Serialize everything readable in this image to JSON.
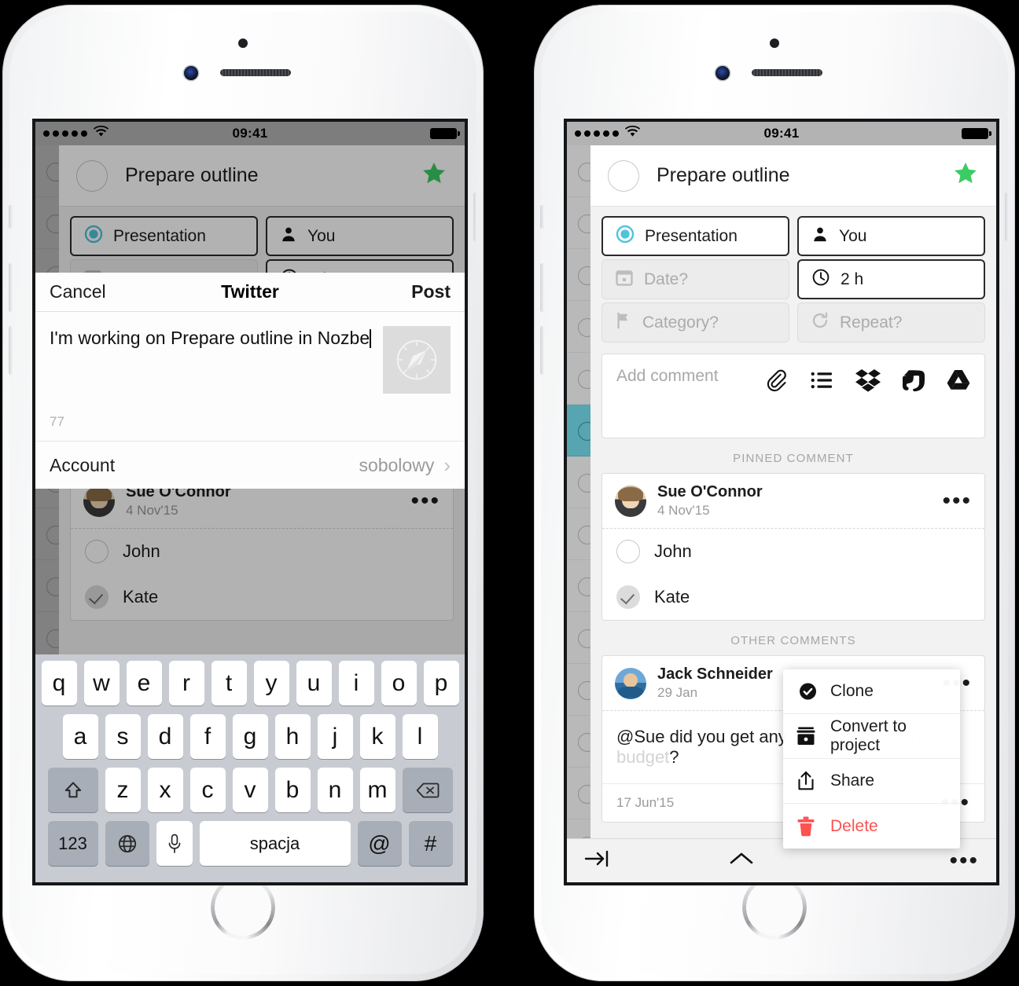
{
  "status_bar": {
    "time": "09:41",
    "signal_dots": 5,
    "wifi": "wifi-icon",
    "battery": "battery-full-icon"
  },
  "task": {
    "title": "Prepare outline",
    "star_color": "#3bcc63",
    "attributes": [
      {
        "label": "Presentation",
        "icon": "project-dot-icon",
        "state": "active"
      },
      {
        "label": "You",
        "icon": "person-icon",
        "state": "active"
      },
      {
        "label": "Date?",
        "icon": "calendar-icon",
        "state": "inactive"
      },
      {
        "label": "2 h",
        "icon": "clock-icon",
        "state": "active"
      },
      {
        "label": "Category?",
        "icon": "flag-icon",
        "state": "inactive"
      },
      {
        "label": "Repeat?",
        "icon": "repeat-icon",
        "state": "inactive"
      }
    ]
  },
  "comment_composer": {
    "placeholder": "Add comment",
    "attachments": [
      {
        "name": "paperclip-icon"
      },
      {
        "name": "checklist-icon"
      },
      {
        "name": "dropbox-icon"
      },
      {
        "name": "evernote-icon"
      },
      {
        "name": "google-drive-icon"
      }
    ]
  },
  "sections": {
    "pinned": "PINNED COMMENT",
    "other": "OTHER COMMENTS"
  },
  "pinned_comment": {
    "author": "Sue O'Connor",
    "date": "4 Nov'15",
    "checklist": [
      {
        "label": "John",
        "done": false
      },
      {
        "label": "Kate",
        "done": true
      }
    ]
  },
  "other_comment": {
    "author": "Jack Schneider",
    "date": "29 Jan",
    "body_visible_start": "@Sue did you get any",
    "body_obscured": " feedback from the budget",
    "body_visible_end": "?",
    "footer_date": "17 Jun'15"
  },
  "bottom_bar": {
    "left_icon": "indent-arrow-icon",
    "center_icon": "chevron-up-icon",
    "right_icon": "more-dots-icon"
  },
  "context_menu": {
    "items": [
      {
        "label": "Clone",
        "icon": "clone-icon",
        "danger": false
      },
      {
        "label": "Convert to project",
        "icon": "archive-box-icon",
        "danger": false
      },
      {
        "label": "Share",
        "icon": "share-upload-icon",
        "danger": false
      },
      {
        "label": "Delete",
        "icon": "trash-icon",
        "danger": true
      }
    ],
    "danger_color": "#fd5252"
  },
  "twitter_sheet": {
    "cancel": "Cancel",
    "title": "Twitter",
    "post": "Post",
    "tweet_text": "I'm working on Prepare outline in Nozbe",
    "char_count": "77",
    "thumbnail_icon": "safari-compass-icon",
    "account_label": "Account",
    "account_value": "sobolowy",
    "chevron": "chevron-right-icon"
  },
  "keyboard": {
    "row1": [
      "q",
      "w",
      "e",
      "r",
      "t",
      "y",
      "u",
      "i",
      "o",
      "p"
    ],
    "row2": [
      "a",
      "s",
      "d",
      "f",
      "g",
      "h",
      "j",
      "k",
      "l"
    ],
    "row3": [
      "z",
      "x",
      "c",
      "v",
      "b",
      "n",
      "m"
    ],
    "shift_icon": "shift-icon",
    "backspace_icon": "backspace-icon",
    "numbers_key": "123",
    "globe_icon": "globe-icon",
    "mic_icon": "microphone-icon",
    "space_key": "spacja",
    "at_key": "@",
    "hash_key": "#"
  }
}
